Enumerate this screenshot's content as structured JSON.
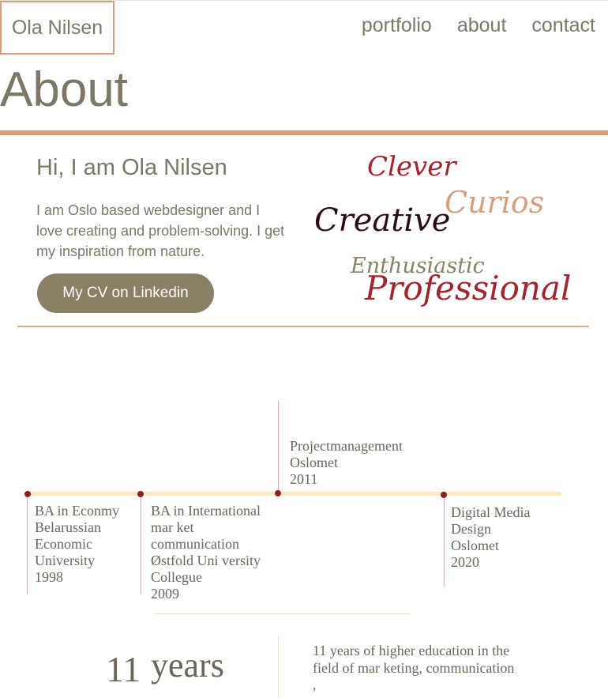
{
  "site": {
    "logo": "Ola Nilsen"
  },
  "nav": {
    "items": [
      "portfolio",
      "about",
      "contact"
    ]
  },
  "page": {
    "title": "About"
  },
  "intro": {
    "heading": "Hi, I am Ola Nilsen",
    "text": "I am Oslo based webdesigner and I love creating and problem-solving. I get my inspiration from nature.",
    "cv_button": "My CV on Linkedin"
  },
  "words": {
    "clever": "Clever",
    "curios": "Curios",
    "creative": "Creative",
    "enthusiastic": "Enthusiastic",
    "professional": "Professional"
  },
  "colors": {
    "accent": "#d99a77",
    "text": "#7d7866",
    "button": "#8a8066",
    "timeline_dot": "#8a2025",
    "timeline_bar": "#fde8c0"
  },
  "timeline": [
    {
      "lines": [
        "BA in Econmy",
        "Belarussian",
        "Economic",
        "University",
        "1998"
      ]
    },
    {
      "lines": [
        "BA in International",
        "mar ket",
        "communication",
        "Østfold Uni versity",
        "Collegue",
        "2009"
      ]
    },
    {
      "lines": [
        "Projectmanagement",
        "Oslomet",
        "2011"
      ]
    },
    {
      "lines": [
        "Digital Media",
        "Design",
        "Oslomet",
        "2020"
      ]
    }
  ],
  "stats": {
    "number": "11",
    "unit": "years",
    "description": "11  years of higher education in the field of mar keting, communication ,"
  }
}
